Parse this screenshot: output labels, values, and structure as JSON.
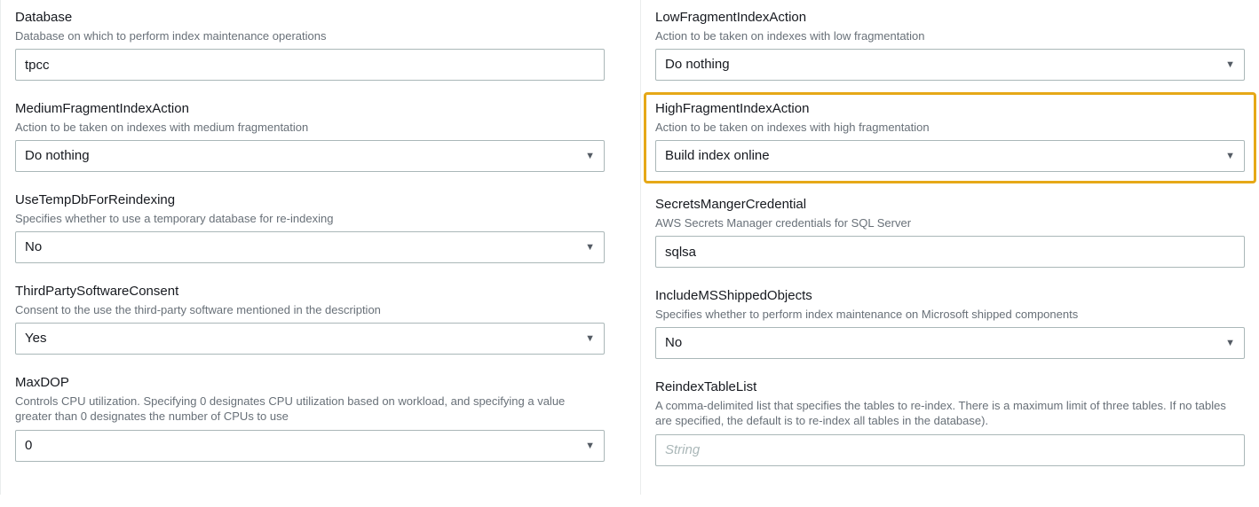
{
  "left": [
    {
      "key": "database",
      "label": "Database",
      "desc": "Database on which to perform index maintenance operations",
      "type": "text",
      "value": "tpcc"
    },
    {
      "key": "medium-fragment-index-action",
      "label": "MediumFragmentIndexAction",
      "desc": "Action to be taken on indexes with medium fragmentation",
      "type": "select",
      "value": "Do nothing"
    },
    {
      "key": "use-temp-db-for-reindexing",
      "label": "UseTempDbForReindexing",
      "desc": "Specifies whether to use a temporary database for re-indexing",
      "type": "select",
      "value": "No"
    },
    {
      "key": "third-party-software-consent",
      "label": "ThirdPartySoftwareConsent",
      "desc": "Consent to the use the third-party software mentioned in the description",
      "type": "select",
      "value": "Yes"
    },
    {
      "key": "max-dop",
      "label": "MaxDOP",
      "desc": "Controls CPU utilization. Specifying 0 designates CPU utilization based on workload, and specifying a value greater than 0 designates the number of CPUs to use",
      "type": "select",
      "value": "0"
    }
  ],
  "right": [
    {
      "key": "low-fragment-index-action",
      "label": "LowFragmentIndexAction",
      "desc": "Action to be taken on indexes with low fragmentation",
      "type": "select",
      "value": "Do nothing"
    },
    {
      "key": "high-fragment-index-action",
      "label": "HighFragmentIndexAction",
      "desc": "Action to be taken on indexes with high fragmentation",
      "type": "select",
      "value": "Build index online",
      "highlighted": true
    },
    {
      "key": "secrets-manager-credential",
      "label": "SecretsMangerCredential",
      "desc": "AWS Secrets Manager credentials for SQL Server",
      "type": "text",
      "value": "sqlsa"
    },
    {
      "key": "include-ms-shipped-objects",
      "label": "IncludeMSShippedObjects",
      "desc": "Specifies whether to perform index maintenance on Microsoft shipped components",
      "type": "select",
      "value": "No"
    },
    {
      "key": "reindex-table-list",
      "label": "ReindexTableList",
      "desc": "A comma-delimited list that specifies the tables to re-index. There is a maximum limit of three tables. If no tables are specified, the default is to re-index all tables in the database).",
      "type": "text",
      "value": "",
      "placeholder": "String"
    }
  ]
}
